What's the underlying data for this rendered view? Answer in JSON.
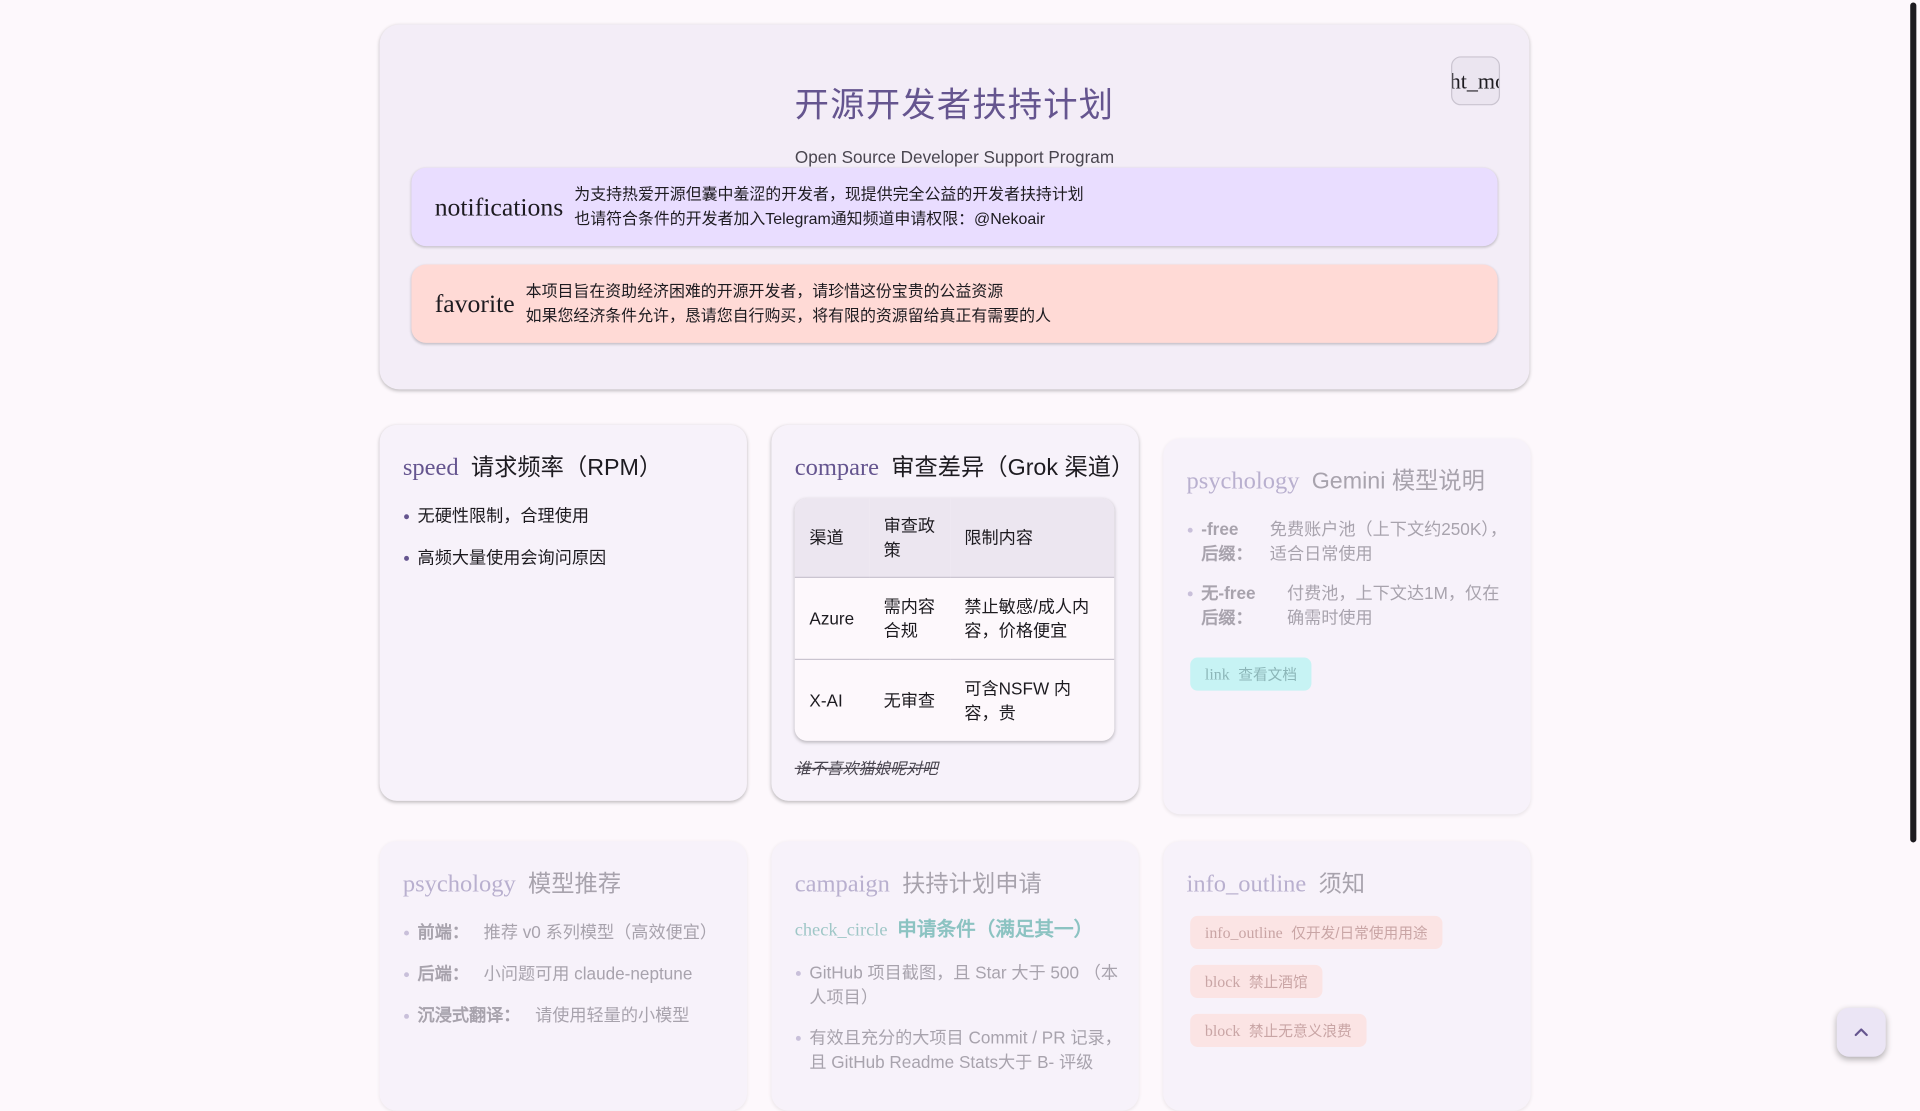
{
  "hero": {
    "title": "开源开发者扶持计划",
    "subtitle": "Open Source Developer Support Program",
    "corner_button_text": "ht_mo",
    "banner_info": {
      "icon": "notifications",
      "line1": "为支持热爱开源但囊中羞涩的开发者，现提供完全公益的开发者扶持计划",
      "line2": "也请符合条件的开发者加入Telegram通知频道申请权限：@Nekoair"
    },
    "banner_warning": {
      "icon": "favorite",
      "line1": "本项目旨在资助经济困难的开源开发者，请珍惜这份宝贵的公益资源",
      "line2": "如果您经济条件允许，恳请您自行购买，将有限的资源留给真正有需要的人"
    }
  },
  "rpm": {
    "icon": "speed",
    "title": "请求频率（RPM）",
    "items": [
      "无硬性限制，合理使用",
      "高频大量使用会询问原因"
    ]
  },
  "compare": {
    "icon": "compare",
    "title": "审查差异（Grok 渠道）",
    "headers": [
      "渠道",
      "审查政策",
      "限制内容"
    ],
    "rows": [
      [
        "Azure",
        "需内容合规",
        "禁止敏感/成人内容，价格便宜"
      ],
      [
        "X-AI",
        "无审查",
        "可含NSFW 内容，贵"
      ]
    ],
    "note": "谁不喜欢猫娘呢对吧"
  },
  "gemini": {
    "icon": "psychology",
    "title": "Gemini 模型说明",
    "items": [
      {
        "key": "-free后缀：",
        "value": "免费账户池（上下文约250K），适合日常使用"
      },
      {
        "key": "无-free后缀：",
        "value": "付费池，上下文达1M，仅在确需时使用"
      }
    ],
    "chip": {
      "icon": "link",
      "label": "查看文档"
    }
  },
  "models": {
    "icon": "psychology",
    "title": "模型推荐",
    "items": [
      {
        "key": "前端：",
        "value": "推荐 v0 系列模型（高效便宜）"
      },
      {
        "key": "后端：",
        "value": "小问题可用 claude-neptune"
      },
      {
        "key": "沉浸式翻译：",
        "value": "请使用轻量的小模型"
      }
    ]
  },
  "apply": {
    "icon": "campaign",
    "title": "扶持计划申请",
    "sub_icon": "check_circle",
    "sub_title": "申请条件（满足其一）",
    "items": [
      "GitHub 项目截图，且 Star 大于 500 （本人项目）",
      "有效且充分的大项目 Commit / PR 记录，且 GitHub Readme Stats大于 B- 评级"
    ]
  },
  "notice": {
    "icon": "info_outline",
    "title": "须知",
    "chips": [
      {
        "icon": "info_outline",
        "label": "仅开发/日常使用用途"
      },
      {
        "icon": "block",
        "label": "禁止酒馆"
      },
      {
        "icon": "block",
        "label": "禁止无意义浪费"
      }
    ]
  },
  "colors": {
    "primary": "#65558f",
    "surface": "#fdf8fc",
    "info_banner": "#e9ddff",
    "warning_banner": "#ffdad6"
  },
  "fab_icon": "arrow-up-icon"
}
